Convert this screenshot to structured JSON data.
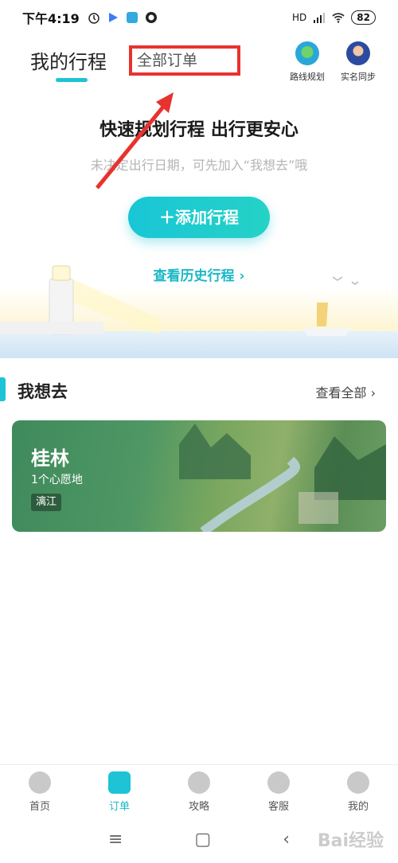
{
  "status": {
    "time": "下午4:19",
    "battery": "82",
    "signal": "HD"
  },
  "header": {
    "title": "我的行程",
    "orders_tab": "全部订单",
    "actions": [
      {
        "label": "路线规划",
        "icon": "map-pin-icon"
      },
      {
        "label": "实名同步",
        "icon": "avatar-icon"
      }
    ]
  },
  "hero": {
    "title": "快速规划行程 出行更安心",
    "subtitle": "未决定出行日期，可先加入“我想去”哦",
    "add_button": "＋添加行程",
    "history_link": "查看历史行程 ›"
  },
  "wishlist": {
    "title": "我想去",
    "view_all": "查看全部 ›",
    "card": {
      "name": "桂林",
      "count": "1个心愿地",
      "tag": "漓江"
    }
  },
  "tabbar": [
    {
      "label": "首页",
      "icon": "home-icon",
      "active": false
    },
    {
      "label": "订单",
      "icon": "order-icon",
      "active": true
    },
    {
      "label": "攻略",
      "icon": "guide-icon",
      "active": false
    },
    {
      "label": "客服",
      "icon": "service-icon",
      "active": false
    },
    {
      "label": "我的",
      "icon": "profile-icon",
      "active": false
    }
  ],
  "navbar": {
    "menu": "≡",
    "home": "▢",
    "back": "‹"
  },
  "watermark": "Bai经验",
  "colors": {
    "accent": "#1ec3d5",
    "annotation": "#e8322e"
  }
}
